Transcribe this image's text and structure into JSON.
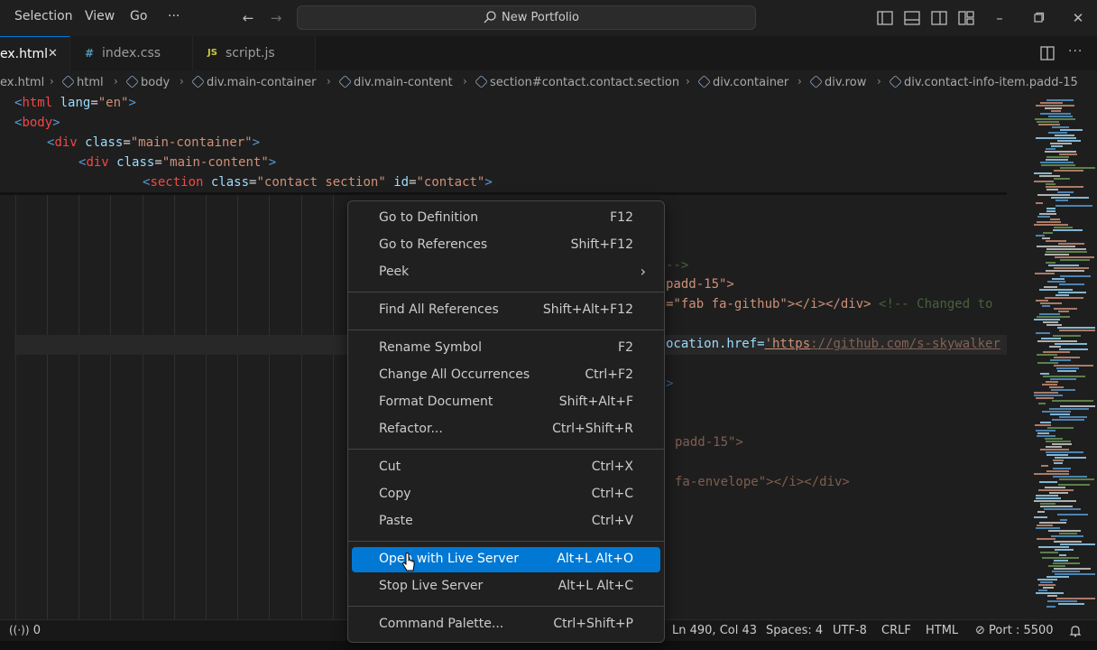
{
  "menu": {
    "selection": "Selection",
    "view": "View",
    "go": "Go",
    "more": "···"
  },
  "search": {
    "text": "New Portfolio"
  },
  "tabs": [
    {
      "label": "ex.html",
      "close": "✕"
    },
    {
      "glyph": "#",
      "label": "index.css"
    },
    {
      "glyph": "JS",
      "label": "script.js"
    }
  ],
  "breadcrumb": [
    "ex.html",
    "html",
    "body",
    "div.main-container",
    "div.main-content",
    "section#contact.contact.section",
    "div.container",
    "div.row",
    "div.contact-info-item.padd-15"
  ],
  "code_top": {
    "l1": {
      "open": "<",
      "name": "html",
      "attr": " lang",
      "eq": "=",
      "val": "\"en\"",
      "close": ">"
    },
    "l2": {
      "open": "<",
      "name": "body",
      "close": ">"
    },
    "l3": {
      "open": "<",
      "name": "div",
      "attr": " class",
      "eq": "=",
      "val": "\"main-container\"",
      "close": ">"
    },
    "l4": {
      "open": "<",
      "name": "div",
      "attr": " class",
      "eq": "=",
      "val": "\"main-content\"",
      "close": ">"
    },
    "l5": {
      "open": "<",
      "name": "section",
      "attr1": " class",
      "eq1": "=",
      "val1": "\"contact section\"",
      "attr2": " id",
      "eq2": "=",
      "val2": "\"contact\"",
      "close": ">"
    }
  },
  "code_visible": {
    "c1": "-->",
    "c2": "padd-15\">",
    "c3a": "=\"fab fa-github\"></i></div>",
    "c3b": "<!-- Changed to",
    "c4a": "ocation.href=",
    "c4b": "'https",
    "c4c": "://github.com/s-skywalker",
    "c5": ">",
    "c6": "padd-15\">",
    "c7": "fa-envelope\"></i></div>"
  },
  "context_menu": [
    {
      "label": "Go to Definition",
      "key": "F12"
    },
    {
      "label": "Go to References",
      "key": "Shift+F12"
    },
    {
      "label": "Peek",
      "key": "›"
    },
    {
      "label": "Find All References",
      "key": "Shift+Alt+F12"
    },
    {
      "label": "Rename Symbol",
      "key": "F2"
    },
    {
      "label": "Change All Occurrences",
      "key": "Ctrl+F2"
    },
    {
      "label": "Format Document",
      "key": "Shift+Alt+F"
    },
    {
      "label": "Refactor...",
      "key": "Ctrl+Shift+R"
    },
    {
      "label": "Cut",
      "key": "Ctrl+X"
    },
    {
      "label": "Copy",
      "key": "Ctrl+C"
    },
    {
      "label": "Paste",
      "key": "Ctrl+V"
    },
    {
      "label": "Open with Live Server",
      "key": "Alt+L Alt+O"
    },
    {
      "label": "Stop Live Server",
      "key": "Alt+L Alt+C"
    },
    {
      "label": "Command Palette...",
      "key": "Ctrl+Shift+P"
    }
  ],
  "statusbar": {
    "remote": "0",
    "position": "Ln 490, Col 43",
    "spaces": "Spaces: 4",
    "encoding": "UTF-8",
    "eol": "CRLF",
    "language": "HTML",
    "port": "Port : 5500"
  },
  "colors": {
    "accent": "#0078d4",
    "tagname": "#f44747",
    "attr": "#9cdcfe",
    "string": "#ce9178"
  }
}
